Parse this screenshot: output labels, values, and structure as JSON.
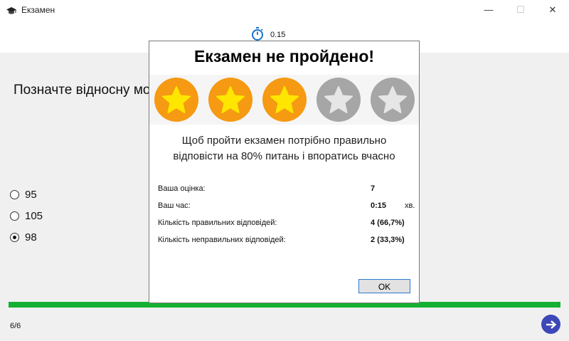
{
  "window": {
    "title": "Екзамен",
    "controls": {
      "minimize": "—",
      "maximize": "☐",
      "close": "✕"
    }
  },
  "header": {
    "timer_icon": "stopwatch-icon",
    "timer_value": "0.15"
  },
  "question": {
    "text": "Позначте відносну мо",
    "answers": [
      {
        "label": "95",
        "checked": false
      },
      {
        "label": "105",
        "checked": false
      },
      {
        "label": "98",
        "checked": true
      }
    ]
  },
  "progress": {
    "fraction": 1.0,
    "page_counter": "6/6",
    "color": "#14b031"
  },
  "next_button": {
    "icon": "arrow-right-icon",
    "color": "#3d47b7"
  },
  "dialog": {
    "title": "Екзамен не пройдено!",
    "stars_filled": 3,
    "stars_total": 5,
    "message": "Щоб пройти екзамен потрібно правильно відповісти на 80% питань і впоратись вчасно",
    "stats": [
      {
        "label": "Ваша оцінка:",
        "value": "7",
        "unit": ""
      },
      {
        "label": "Ваш час:",
        "value": "0:15",
        "unit": "хв."
      },
      {
        "label": "Кількість правильних відповідей:",
        "value": "4 (66,7%)",
        "unit": ""
      },
      {
        "label": "Кількість неправильних відповідей:",
        "value": "2 (33,3%)",
        "unit": ""
      }
    ],
    "ok_label": "OK"
  }
}
